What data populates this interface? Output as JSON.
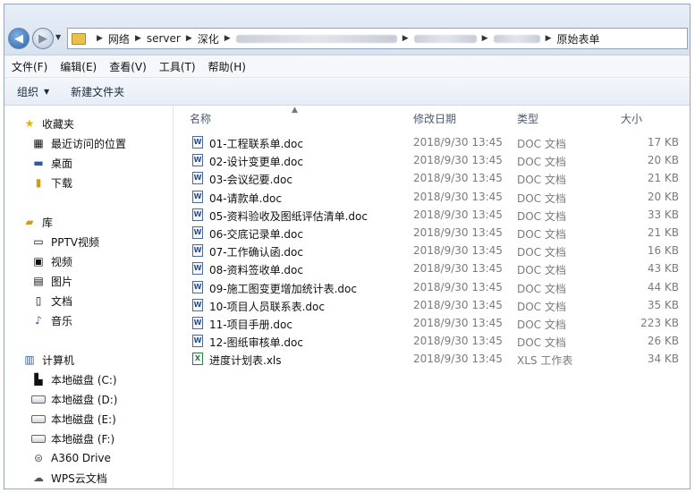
{
  "address": {
    "crumbs": [
      "网络",
      "server",
      "深化"
    ],
    "current": "原始表单"
  },
  "menu": [
    "文件(F)",
    "编辑(E)",
    "查看(V)",
    "工具(T)",
    "帮助(H)"
  ],
  "toolbar": {
    "organize": "组织",
    "new_folder": "新建文件夹"
  },
  "nav": {
    "favorites": "收藏夹",
    "recent": "最近访问的位置",
    "desktop": "桌面",
    "downloads": "下载",
    "library": "库",
    "pptv": "PPTV视频",
    "video": "视频",
    "pictures": "图片",
    "documents": "文档",
    "music": "音乐",
    "computer": "计算机",
    "disk_c": "本地磁盘 (C:)",
    "disk_d": "本地磁盘 (D:)",
    "disk_e": "本地磁盘 (E:)",
    "disk_f": "本地磁盘 (F:)",
    "a360": "A360 Drive",
    "wps": "WPS云文档"
  },
  "columns": {
    "name": "名称",
    "date": "修改日期",
    "type": "类型",
    "size": "大小"
  },
  "files": [
    {
      "name": "01-工程联系单.doc",
      "date": "2018/9/30 13:45",
      "type": "DOC 文档",
      "size": "17 KB",
      "icon": "doc-icon"
    },
    {
      "name": "02-设计变更单.doc",
      "date": "2018/9/30 13:45",
      "type": "DOC 文档",
      "size": "20 KB",
      "icon": "doc-icon"
    },
    {
      "name": "03-会议纪要.doc",
      "date": "2018/9/30 13:45",
      "type": "DOC 文档",
      "size": "21 KB",
      "icon": "doc-icon"
    },
    {
      "name": "04-请款单.doc",
      "date": "2018/9/30 13:45",
      "type": "DOC 文档",
      "size": "20 KB",
      "icon": "doc-icon"
    },
    {
      "name": "05-资料验收及图纸评估清单.doc",
      "date": "2018/9/30 13:45",
      "type": "DOC 文档",
      "size": "33 KB",
      "icon": "doc-icon"
    },
    {
      "name": "06-交底记录单.doc",
      "date": "2018/9/30 13:45",
      "type": "DOC 文档",
      "size": "21 KB",
      "icon": "doc-icon"
    },
    {
      "name": "07-工作确认函.doc",
      "date": "2018/9/30 13:45",
      "type": "DOC 文档",
      "size": "16 KB",
      "icon": "doc-icon"
    },
    {
      "name": "08-资料签收单.doc",
      "date": "2018/9/30 13:45",
      "type": "DOC 文档",
      "size": "43 KB",
      "icon": "doc-icon"
    },
    {
      "name": "09-施工图变更增加统计表.doc",
      "date": "2018/9/30 13:45",
      "type": "DOC 文档",
      "size": "44 KB",
      "icon": "doc-icon"
    },
    {
      "name": "10-项目人员联系表.doc",
      "date": "2018/9/30 13:45",
      "type": "DOC 文档",
      "size": "35 KB",
      "icon": "doc-icon"
    },
    {
      "name": "11-项目手册.doc",
      "date": "2018/9/30 13:45",
      "type": "DOC 文档",
      "size": "223 KB",
      "icon": "doc-icon"
    },
    {
      "name": "12-图纸审核单.doc",
      "date": "2018/9/30 13:45",
      "type": "DOC 文档",
      "size": "26 KB",
      "icon": "doc-icon"
    },
    {
      "name": "进度计划表.xls",
      "date": "2018/9/30 13:45",
      "type": "XLS 工作表",
      "size": "34 KB",
      "icon": "xls-icon"
    }
  ]
}
